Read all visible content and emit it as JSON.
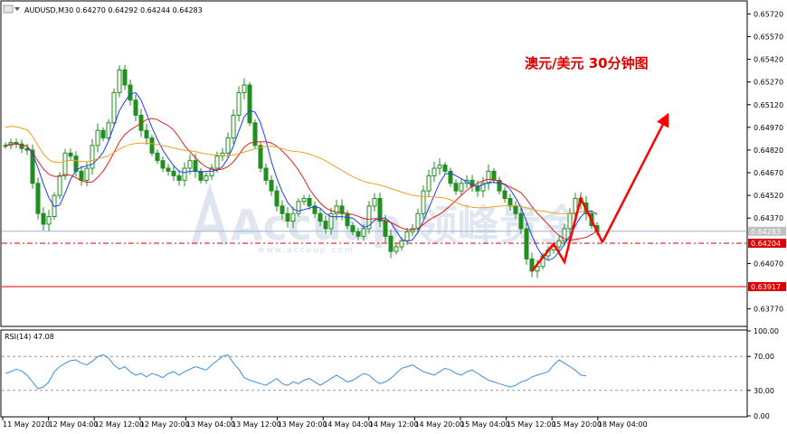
{
  "header": {
    "symbol_info": "AUDUSD,M30  0.64270 0.64292 0.64244 0.64283"
  },
  "annotation": {
    "title": "澳元/美元 30分钟图",
    "color": "#e00000"
  },
  "watermark": {
    "text": "Accuup 领峰贵金",
    "subtext": "www.accuup.com"
  },
  "rsi": {
    "label": "RSI(14) 47.08",
    "period": 14,
    "value": 47.08,
    "levels": [
      70,
      30
    ],
    "axis_labels": [
      "100.00",
      "70.00",
      "30.00",
      "0.00"
    ]
  },
  "price_axis": {
    "labels": [
      "0.65720",
      "0.65570",
      "0.65420",
      "0.65270",
      "0.65120",
      "0.64970",
      "0.64820",
      "0.64670",
      "0.64520",
      "0.64370",
      "0.64070",
      "0.63770"
    ],
    "tags": [
      {
        "text": "0.64283",
        "color": "#c0c0c0"
      },
      {
        "text": "0.64204",
        "color": "#e00000"
      },
      {
        "text": "0.63917",
        "color": "#e00000"
      }
    ]
  },
  "time_axis": {
    "labels": [
      "11 May 2020",
      "12 May 04:00",
      "12 May 12:00",
      "12 May 20:00",
      "13 May 04:00",
      "13 May 12:00",
      "13 May 20:00",
      "14 May 04:00",
      "14 May 12:00",
      "14 May 20:00",
      "15 May 04:00",
      "15 May 12:00",
      "15 May 20:00",
      "18 May 04:00"
    ]
  },
  "colors": {
    "bull": "#1f8f1f",
    "bear": "#1f8f1f",
    "ma_fast": "#1e3cff",
    "ma_mid": "#e02020",
    "ma_slow": "#f0a020",
    "rsi_line": "#3b8fe0",
    "arrow": "#ff0000"
  },
  "chart_data": {
    "type": "candlestick",
    "symbol": "AUDUSD",
    "timeframe": "M30",
    "ylim": [
      0.6366,
      0.658
    ],
    "horizontal_levels": [
      {
        "value": 0.64283,
        "style": "solid",
        "color": "#9fb4d0"
      },
      {
        "value": 0.64204,
        "style": "dash-dot",
        "color": "#e00000"
      },
      {
        "value": 0.63917,
        "style": "solid",
        "color": "#e00000"
      }
    ],
    "price_path": [
      0.6485,
      0.6487,
      0.6486,
      0.6483,
      0.6482,
      0.646,
      0.644,
      0.6433,
      0.6438,
      0.6452,
      0.6465,
      0.648,
      0.6478,
      0.6468,
      0.6462,
      0.647,
      0.6485,
      0.6495,
      0.649,
      0.65,
      0.652,
      0.6535,
      0.6525,
      0.6515,
      0.6505,
      0.6495,
      0.649,
      0.648,
      0.6475,
      0.647,
      0.6468,
      0.6465,
      0.6462,
      0.647,
      0.6475,
      0.6468,
      0.6462,
      0.6465,
      0.647,
      0.6478,
      0.648,
      0.649,
      0.6505,
      0.652,
      0.6525,
      0.65,
      0.6485,
      0.647,
      0.6462,
      0.6455,
      0.6445,
      0.644,
      0.6435,
      0.644,
      0.6448,
      0.645,
      0.6445,
      0.644,
      0.6435,
      0.643,
      0.644,
      0.6445,
      0.644,
      0.6432,
      0.6428,
      0.6425,
      0.643,
      0.6445,
      0.645,
      0.6435,
      0.6425,
      0.6415,
      0.6418,
      0.6422,
      0.6428,
      0.643,
      0.644,
      0.6455,
      0.6465,
      0.647,
      0.6472,
      0.6468,
      0.646,
      0.6455,
      0.646,
      0.6462,
      0.6458,
      0.6455,
      0.646,
      0.6468,
      0.6462,
      0.6455,
      0.645,
      0.6445,
      0.644,
      0.643,
      0.641,
      0.6402,
      0.6405,
      0.6412,
      0.6416,
      0.6418,
      0.6422,
      0.643,
      0.644,
      0.645,
      0.6447,
      0.644,
      0.6432,
      0.6428
    ],
    "moving_averages": [
      {
        "name": "MA fast",
        "color": "#1e3cff",
        "period": 5
      },
      {
        "name": "MA mid",
        "color": "#e02020",
        "period": 12
      },
      {
        "name": "MA slow",
        "color": "#f0a020",
        "period": 40
      }
    ],
    "zigzag": [
      {
        "time_index": 97,
        "price": 0.6402
      },
      {
        "time_index": 101,
        "price": 0.642
      },
      {
        "time_index": 103,
        "price": 0.6408
      },
      {
        "time_index": 106,
        "price": 0.645
      },
      {
        "time_index": 110,
        "price": 0.6421
      }
    ],
    "forecast_arrow": {
      "from_price": 0.6421,
      "to_price": 0.6505
    },
    "rsi_values": [
      50,
      52,
      55,
      53,
      48,
      40,
      32,
      34,
      40,
      52,
      58,
      62,
      65,
      66,
      62,
      60,
      64,
      70,
      72,
      68,
      60,
      55,
      58,
      52,
      48,
      50,
      46,
      50,
      48,
      45,
      50,
      52,
      48,
      52,
      55,
      58,
      56,
      54,
      60,
      65,
      70,
      72,
      62,
      55,
      45,
      42,
      40,
      38,
      36,
      40,
      44,
      38,
      36,
      40,
      38,
      42,
      44,
      40,
      36,
      40,
      44,
      48,
      44,
      40,
      42,
      46,
      50,
      48,
      42,
      38,
      40,
      44,
      50,
      56,
      58,
      60,
      56,
      52,
      50,
      48,
      52,
      56,
      54,
      50,
      48,
      52,
      54,
      50,
      46,
      42,
      40,
      38,
      36,
      34,
      36,
      40,
      42,
      46,
      48,
      50,
      52,
      60,
      66,
      62,
      58,
      54,
      48,
      47
    ]
  }
}
